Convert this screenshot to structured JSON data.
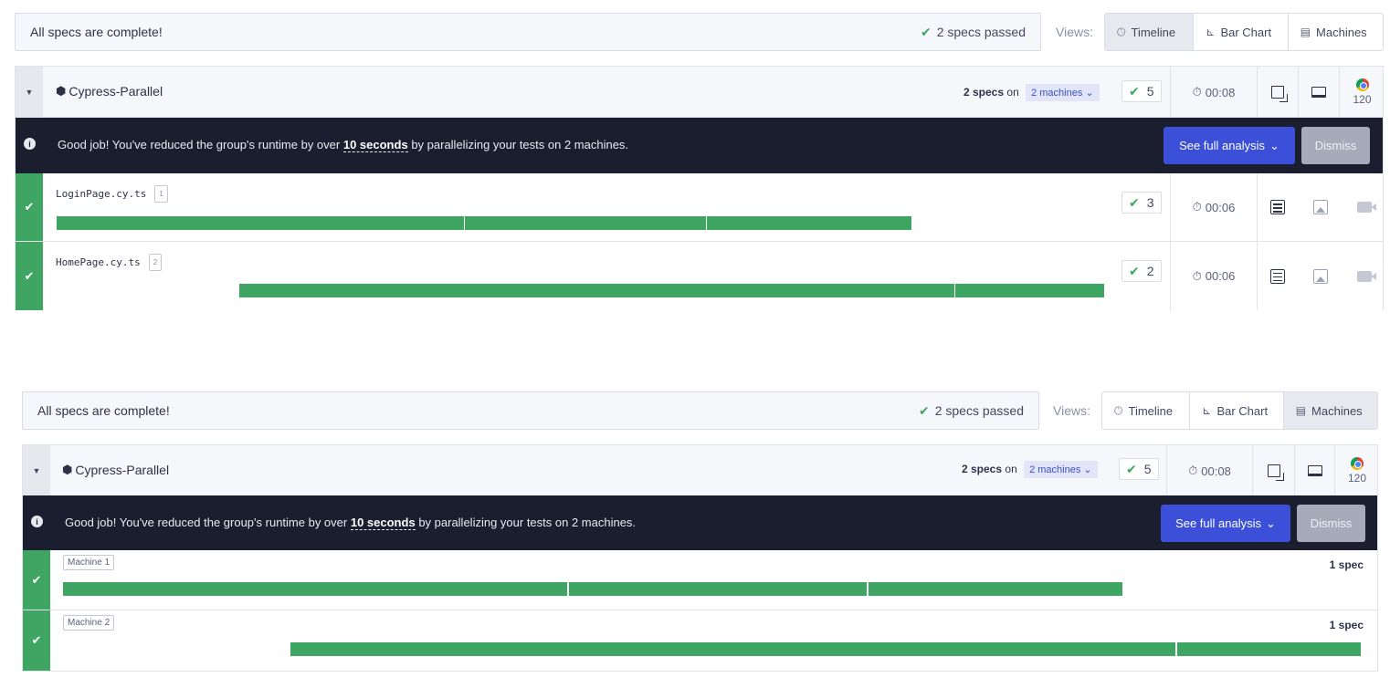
{
  "status": {
    "message": "All specs are complete!",
    "passed": "2 specs passed"
  },
  "views": {
    "label": "Views:",
    "timeline": "Timeline",
    "bar_chart": "Bar Chart",
    "machines": "Machines"
  },
  "group": {
    "name": "Cypress-Parallel",
    "specs_count": "2 specs",
    "on": "on",
    "machines": "2 machines",
    "passed_count": "5",
    "duration": "00:08",
    "browser_version": "120"
  },
  "banner": {
    "prefix": "Good job! You've reduced the group's runtime by over",
    "highlight": "10 seconds",
    "suffix": "by parallelizing your tests on 2 machines.",
    "analysis_button": "See full analysis",
    "dismiss_button": "Dismiss"
  },
  "specs": [
    {
      "file": "LoginPage.cy.ts",
      "index": "1",
      "passed": "3",
      "duration": "00:06"
    },
    {
      "file": "HomePage.cy.ts",
      "index": "2",
      "passed": "2",
      "duration": "00:06"
    }
  ],
  "machines": [
    {
      "label": "Machine 1",
      "specs": "1 spec"
    },
    {
      "label": "Machine 2",
      "specs": "1 spec"
    }
  ],
  "colors": {
    "pass_green": "#3ea662",
    "banner_bg": "#1b1e2e",
    "analysis_blue": "#3b4fd9",
    "dismiss_gray": "#a7aab9"
  }
}
